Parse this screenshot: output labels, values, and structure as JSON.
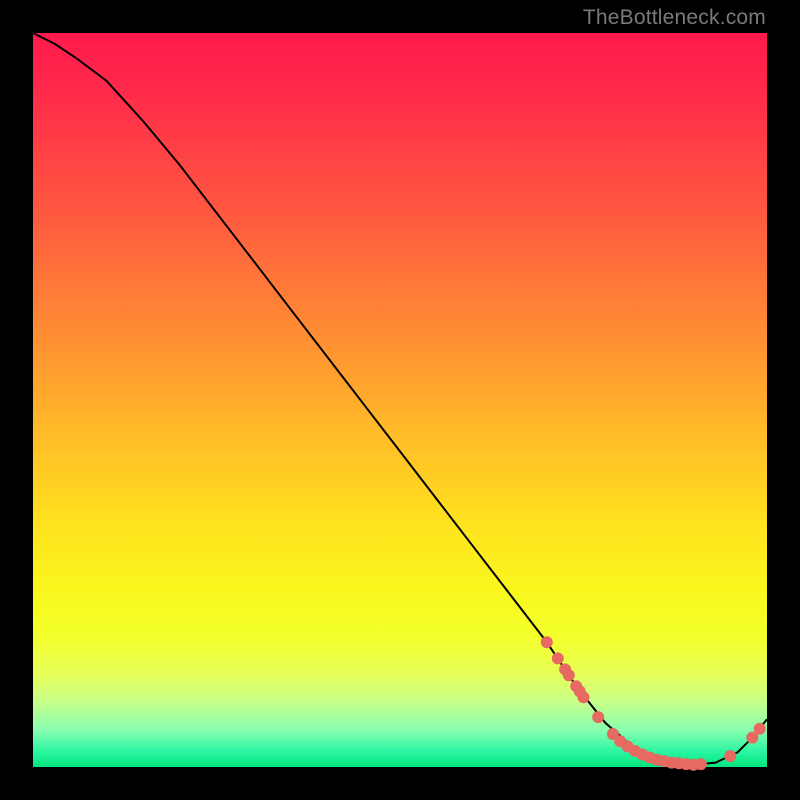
{
  "watermark": "TheBottleneck.com",
  "colors": {
    "background": "#000000",
    "curve": "#000000",
    "dot": "#e66a62"
  },
  "chart_data": {
    "type": "line",
    "title": "",
    "xlabel": "",
    "ylabel": "",
    "xlim": [
      0,
      100
    ],
    "ylim": [
      0,
      100
    ],
    "grid": false,
    "series": [
      {
        "name": "bottleneck-curve",
        "x": [
          0,
          3,
          6,
          10,
          15,
          20,
          25,
          30,
          35,
          40,
          45,
          50,
          55,
          60,
          65,
          70,
          74,
          78,
          82,
          86,
          90,
          93,
          96,
          98,
          100
        ],
        "y": [
          100,
          98.5,
          96.5,
          93.5,
          88,
          82,
          75.5,
          69,
          62.5,
          56,
          49.5,
          43,
          36.5,
          30,
          23.5,
          17,
          11,
          6,
          2.5,
          0.8,
          0.3,
          0.6,
          2.0,
          4.0,
          6.5
        ]
      }
    ],
    "scatter": [
      {
        "name": "highlight-points",
        "x": [
          70,
          71.5,
          72.5,
          73,
          74,
          74.5,
          75,
          77,
          79,
          80,
          81,
          82,
          83,
          84,
          85,
          86,
          87,
          88,
          89,
          90,
          91,
          95,
          98,
          99
        ],
        "y": [
          17,
          14.8,
          13.3,
          12.5,
          11,
          10.3,
          9.5,
          6.8,
          4.5,
          3.5,
          2.8,
          2.2,
          1.7,
          1.3,
          1.0,
          0.8,
          0.6,
          0.5,
          0.4,
          0.3,
          0.4,
          1.5,
          4.0,
          5.2
        ]
      }
    ]
  }
}
